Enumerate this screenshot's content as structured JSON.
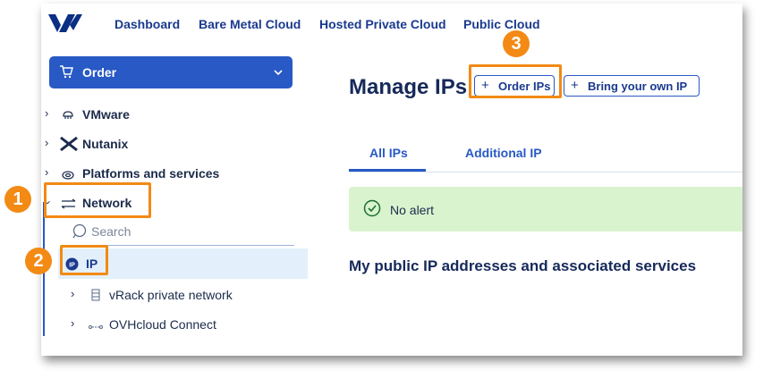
{
  "nav": {
    "items": [
      "Dashboard",
      "Bare Metal Cloud",
      "Hosted Private Cloud",
      "Public Cloud"
    ]
  },
  "sidebar": {
    "order_label": "Order",
    "items": [
      {
        "label": "VMware",
        "icon": "vmware-icon"
      },
      {
        "label": "Nutanix",
        "icon": "nutanix-icon"
      },
      {
        "label": "Platforms and services",
        "icon": "platforms-icon"
      },
      {
        "label": "Network",
        "icon": "network-arrows-icon"
      }
    ],
    "search_placeholder": "Search",
    "ip_label": "IP",
    "subitems": [
      {
        "label": "vRack private network",
        "icon": "vrack-icon"
      },
      {
        "label": "OVHcloud Connect",
        "icon": "connect-icon"
      }
    ]
  },
  "main": {
    "title": "Manage IPs",
    "order_ips_label": "Order IPs",
    "byoip_label": "Bring your own IP",
    "tabs": [
      "All IPs",
      "Additional IP"
    ],
    "alert_text": "No alert",
    "section_title": "My public IP addresses and associated services"
  },
  "annotations": {
    "badges": [
      "1",
      "2",
      "3"
    ]
  },
  "colors": {
    "accent": "#2859c5",
    "highlight": "#f28a14",
    "alert_bg": "#d9f3cf"
  }
}
